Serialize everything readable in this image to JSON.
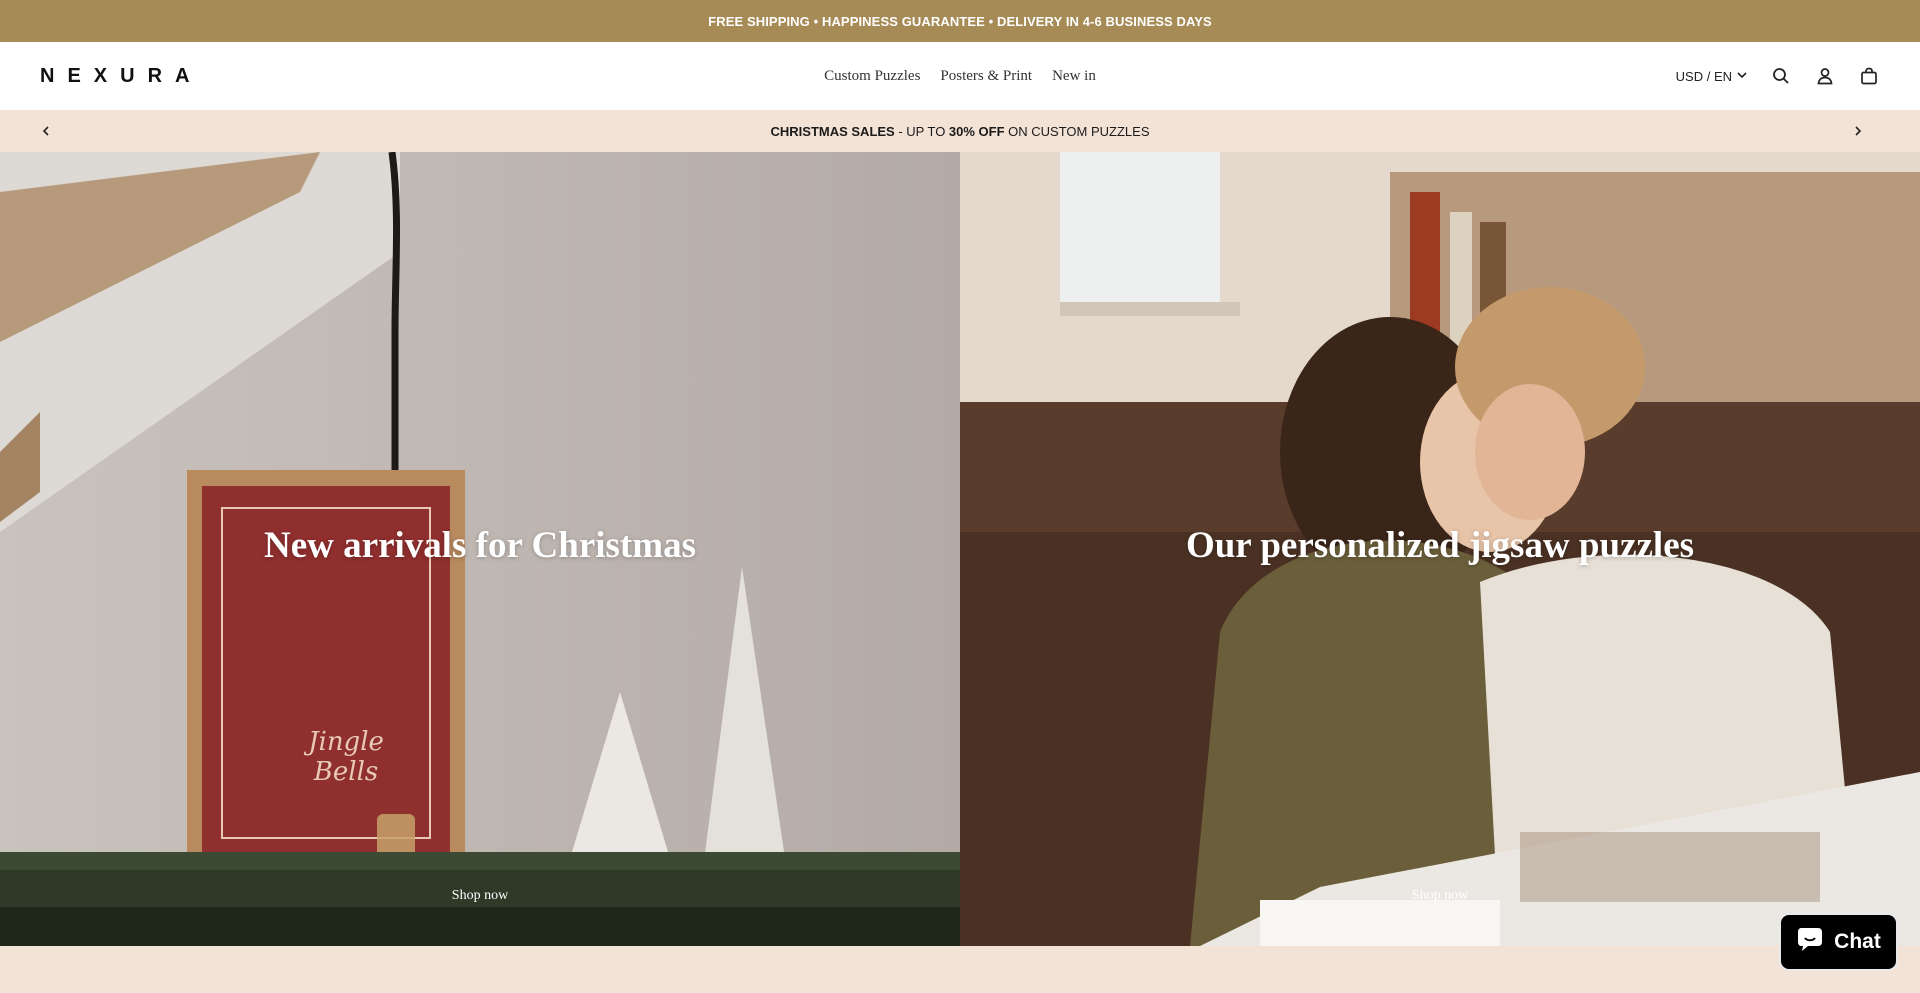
{
  "announcement": "FREE SHIPPING • HAPPINESS GUARANTEE • DELIVERY IN 4-6 BUSINESS DAYS",
  "header": {
    "logo": "NEXURA",
    "nav": [
      "Custom Puzzles",
      "Posters & Print",
      "New in"
    ],
    "locale": "USD / EN",
    "icons": [
      "search-icon",
      "account-icon",
      "cart-icon"
    ]
  },
  "promo": {
    "bold": "CHRISTMAS SALES",
    "middle": " - UP TO ",
    "discount": "30% OFF",
    "tail": " ON CUSTOM PUZZLES"
  },
  "hero": [
    {
      "title": "New arrivals for Christmas",
      "cta": "Shop now"
    },
    {
      "title": "Our personalized jigsaw puzzles",
      "cta": "Shop now"
    }
  ],
  "chat": {
    "label": "Chat"
  },
  "colors": {
    "announcement_bg": "#a68b56",
    "promo_bg": "#f3e2d6",
    "header_bg": "#ffffff"
  }
}
